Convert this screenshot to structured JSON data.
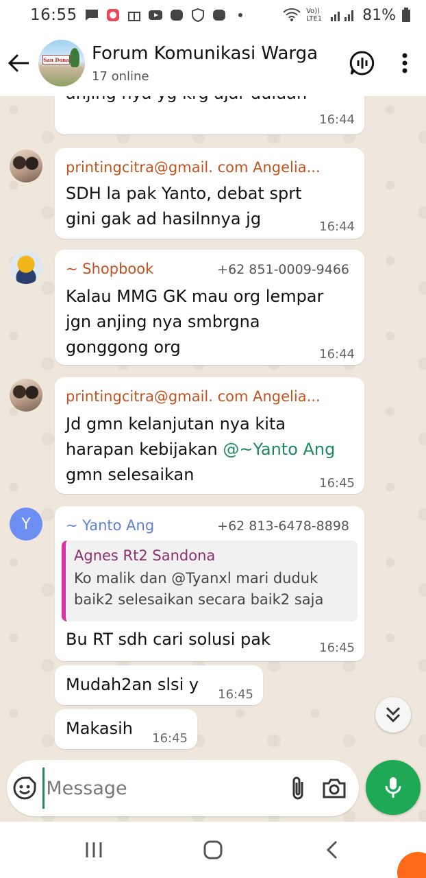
{
  "status_bar": {
    "time": "16:55",
    "network": "Vo)) LTE1",
    "battery": "81%"
  },
  "header": {
    "title": "Forum Komunikasi Warga",
    "subtitle": "17 online",
    "avatar_text": "San Dona"
  },
  "messages": [
    {
      "type": "continuation",
      "text": "anjing nya yg krg ajar duluan",
      "time": "16:44"
    },
    {
      "type": "group",
      "sender": "printingcitra@gmail. com Angelia...",
      "text_lines": [
        "SDH la pak Yanto, debat sprt",
        "gini gak ad hasilnnya jg"
      ],
      "time": "16:44"
    },
    {
      "type": "group",
      "sender": "~ Shopbook",
      "phone": "+62 851-0009-9466",
      "text_lines": [
        "Kalau MMG GK mau org lempar",
        "jgn anjing nya smbrgna",
        "gonggong org"
      ],
      "time": "16:44"
    },
    {
      "type": "group",
      "sender": "printingcitra@gmail. com Angelia...",
      "text_lines": [
        "Jd gmn kelanjutan nya kita",
        "harapan kebijakan"
      ],
      "mention": "@~Yanto Ang",
      "text_end": "gmn selesaikan",
      "time": "16:45"
    },
    {
      "type": "reply",
      "sender": "~ Yanto Ang",
      "phone": "+62 813-6478-8898",
      "avatar_letter": "Y",
      "quote_name": "Agnes Rt2 Sandona",
      "quote_lines": [
        "Ko malik dan  @Tyanxl mari duduk",
        "baik2 selesaikan secara baik2 saja"
      ],
      "text": "Bu RT sdh cari solusi pak",
      "time": "16:45"
    },
    {
      "type": "continuation",
      "text": "Mudah2an slsi y",
      "time": "16:45"
    },
    {
      "type": "continuation",
      "text": "Makasih",
      "time": "16:45"
    }
  ],
  "input": {
    "placeholder": "Message"
  },
  "icons": {
    "back": "arrow-left-icon",
    "voice_chat": "voice-chat-icon",
    "menu": "more-vert-icon",
    "emoji": "emoji-icon",
    "attach": "paperclip-icon",
    "camera": "camera-icon",
    "mic": "mic-icon",
    "scroll_down": "double-chevron-down-icon"
  },
  "colors": {
    "accent": "#1fa855",
    "sender": "#c4521e",
    "mention": "#1b8a5a",
    "quote_bar": "#d634a8"
  }
}
